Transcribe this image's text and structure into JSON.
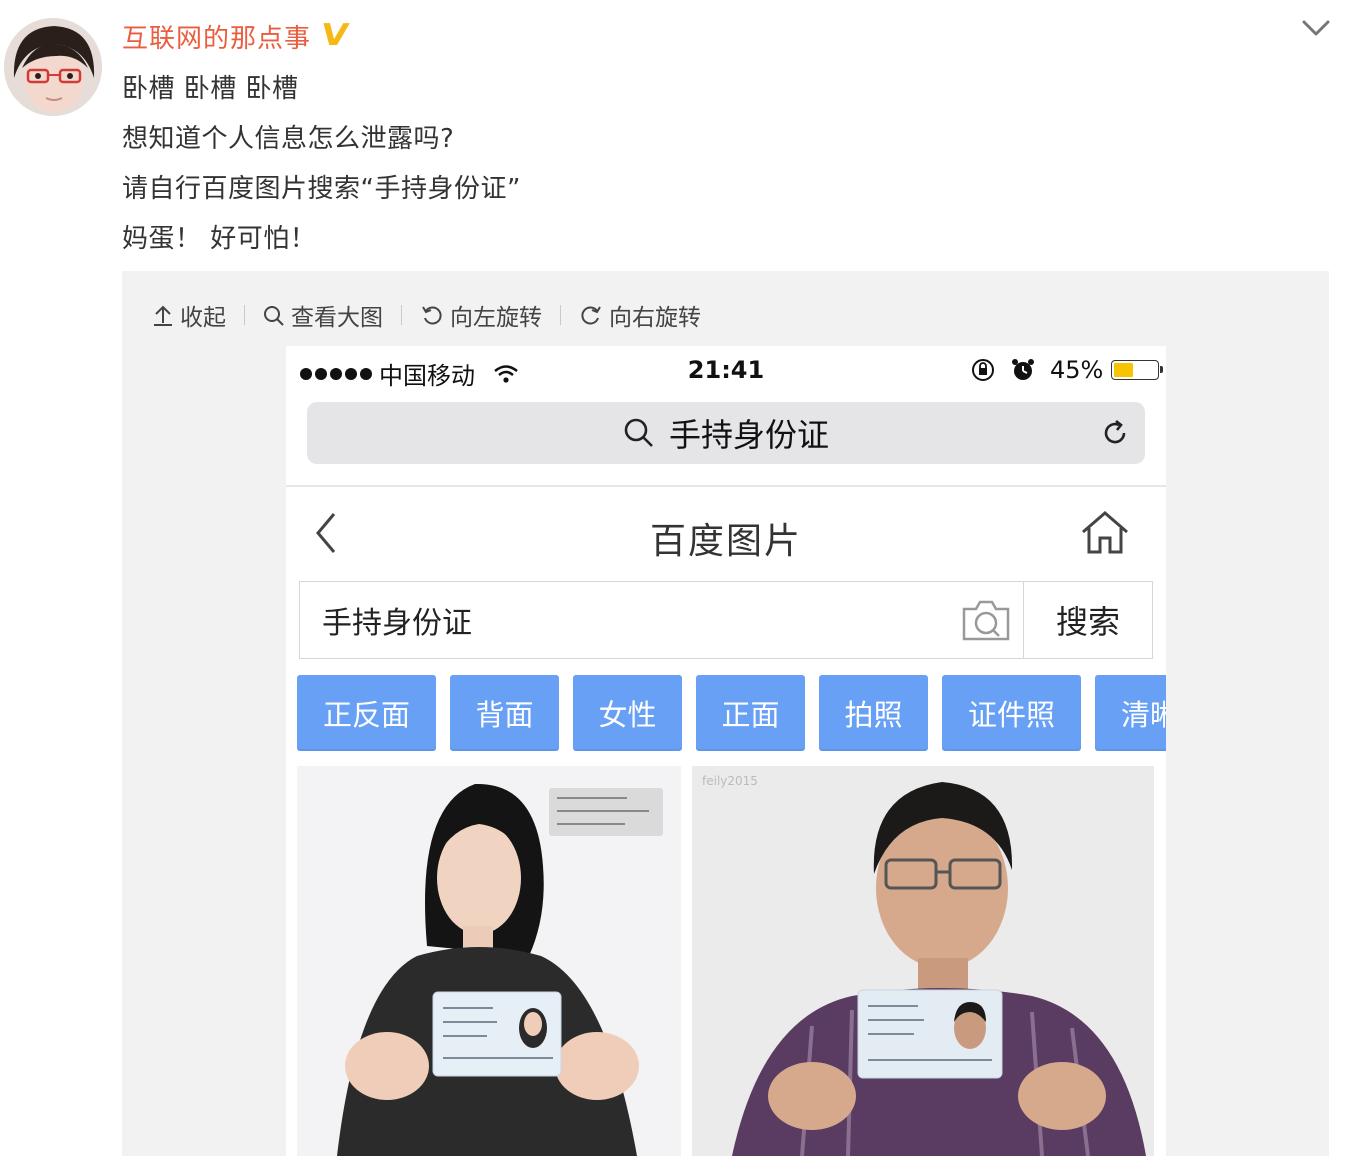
{
  "post": {
    "author": "互联网的那点事",
    "verified_badge": "V",
    "lines": [
      "卧槽 卧槽 卧槽",
      "想知道个人信息怎么泄露吗?",
      "请自行百度图片搜索“手持身份证”",
      "妈蛋！ 好可怕！"
    ]
  },
  "media_toolbar": {
    "collapse": "收起",
    "view_large": "查看大图",
    "rotate_left": "向左旋转",
    "rotate_right": "向右旋转"
  },
  "phone": {
    "status_bar": {
      "carrier": "中国移动",
      "time": "21:41",
      "battery": "45%",
      "battery_level": 0.45
    },
    "url_bar": {
      "query": "手持身份证"
    },
    "nav": {
      "title": "百度图片"
    },
    "search": {
      "value": "手持身份证",
      "button": "搜索"
    },
    "tags": [
      "正反面",
      "背面",
      "女性",
      "正面",
      "拍照",
      "证件照",
      "清晰"
    ],
    "results": [
      {
        "alt": "woman-holding-id-card"
      },
      {
        "alt": "man-holding-id-card",
        "watermark": "feily2015"
      }
    ]
  },
  "colors": {
    "author": "#eb5d3f",
    "verified": "#f5b915",
    "tag_bg": "#67a0f5",
    "battery": "#f6c400"
  }
}
